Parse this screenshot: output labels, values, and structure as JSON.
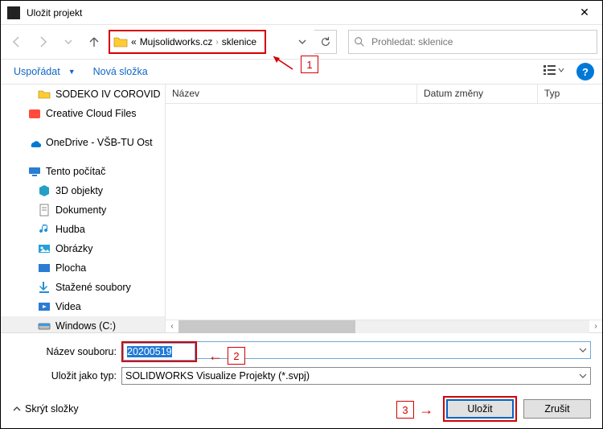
{
  "window": {
    "title": "Uložit projekt",
    "close": "✕"
  },
  "nav": {
    "breadcrumb_prefix": "«",
    "breadcrumb_part1": "Mujsolidworks.cz",
    "breadcrumb_part2": "sklenice",
    "search_placeholder": "Prohledat: sklenice"
  },
  "toolbar": {
    "organize": "Uspořádat",
    "new_folder": "Nová složka"
  },
  "tree": [
    {
      "label": "SODEKO IV COROVID",
      "icon": "folder",
      "indent": 1
    },
    {
      "label": "Creative Cloud Files",
      "icon": "ccloud",
      "indent": 0
    },
    {
      "label": "OneDrive - VŠB-TU Ost",
      "icon": "onedrive",
      "indent": 0
    },
    {
      "label": "Tento počítač",
      "icon": "pc",
      "indent": 0
    },
    {
      "label": "3D objekty",
      "icon": "3d",
      "indent": 1
    },
    {
      "label": "Dokumenty",
      "icon": "docs",
      "indent": 1
    },
    {
      "label": "Hudba",
      "icon": "music",
      "indent": 1
    },
    {
      "label": "Obrázky",
      "icon": "images",
      "indent": 1
    },
    {
      "label": "Plocha",
      "icon": "desktop",
      "indent": 1
    },
    {
      "label": "Stažené soubory",
      "icon": "downloads",
      "indent": 1
    },
    {
      "label": "Videa",
      "icon": "videos",
      "indent": 1
    },
    {
      "label": "Windows (C:)",
      "icon": "disk",
      "indent": 1,
      "sel": true
    }
  ],
  "list": {
    "col_name": "Název",
    "col_date": "Datum změny",
    "col_type": "Typ"
  },
  "form": {
    "filename_label": "Název souboru:",
    "filename_value": "20200519",
    "filetype_label": "Uložit jako typ:",
    "filetype_value": "SOLIDWORKS Visualize Projekty (*.svpj)"
  },
  "footer": {
    "hide_folders": "Skrýt složky",
    "save": "Uložit",
    "cancel": "Zrušit"
  },
  "annotations": {
    "n1": "1",
    "n2": "2",
    "n3": "3"
  }
}
